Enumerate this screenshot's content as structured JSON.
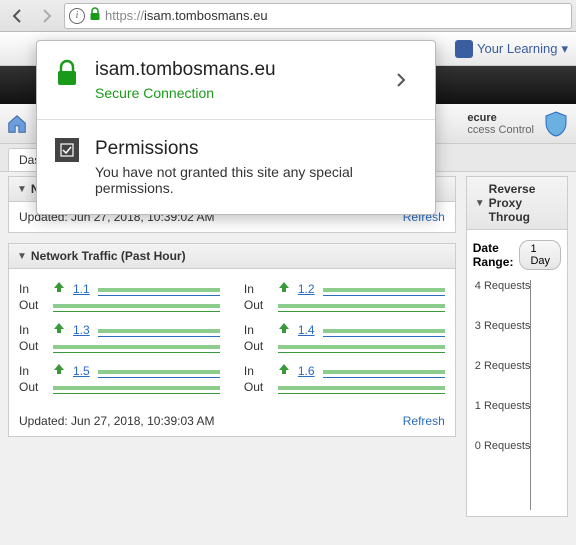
{
  "browser": {
    "url_protocol": "https://",
    "url_host": "isam.tombosmans.eu"
  },
  "popup": {
    "host": "isam.tombosmans.eu",
    "conn": "Secure Connection",
    "perm_title": "Permissions",
    "perm_text": "You have not granted this site any special permissions."
  },
  "topnav": {
    "learning": "Your Learning"
  },
  "mega": {
    "l1": "ecure",
    "l2": "ccess Control"
  },
  "tabs": {
    "dash": "Das"
  },
  "notifications": {
    "title": "Notifications",
    "updated": "Updated: Jun 27, 2018, 10:39:02 AM",
    "refresh": "Refresh"
  },
  "network": {
    "title": "Network Traffic (Past Hour)",
    "in": "In",
    "out": "Out",
    "nics": [
      "1.1",
      "1.2",
      "1.3",
      "1.4",
      "1.5",
      "1.6"
    ],
    "updated": "Updated: Jun 27, 2018, 10:39:03 AM",
    "refresh": "Refresh"
  },
  "proxy": {
    "title": "Reverse Proxy Throug",
    "date_range_label": "Date Range:",
    "date_range_value": "1 Day"
  },
  "chart_data": {
    "type": "bar",
    "title": "Reverse Proxy Throughput",
    "ylabel": "Requests",
    "ylim": [
      0,
      4
    ],
    "yticks": [
      "4 Requests",
      "3 Requests",
      "2 Requests",
      "1 Requests",
      "0 Requests"
    ],
    "series": [],
    "categories": []
  }
}
